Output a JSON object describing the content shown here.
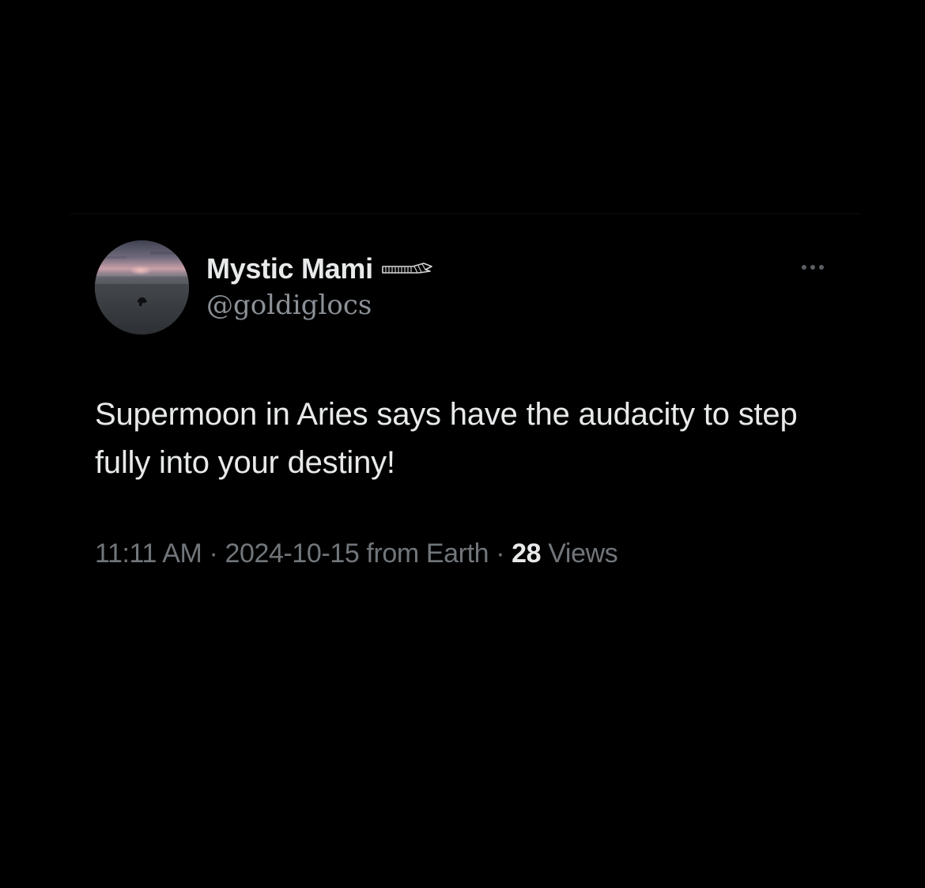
{
  "tweet": {
    "author": {
      "display_name": "Mystic Mami",
      "handle": "@goldiglocs",
      "badge_icon": "wing-icon",
      "avatar_icon": "avatar-sunset-photo"
    },
    "more_icon": "more-dots-icon",
    "text": "Supermoon in Aries says have the audacity to step fully into your destiny!",
    "time": "11:11 AM",
    "separator": "·",
    "date_source": "2024-10-15 from Earth",
    "views_count": "28",
    "views_label": "Views"
  },
  "colors": {
    "background": "#000000",
    "primary_text": "#e7e9ea",
    "secondary_text": "#71767b"
  }
}
